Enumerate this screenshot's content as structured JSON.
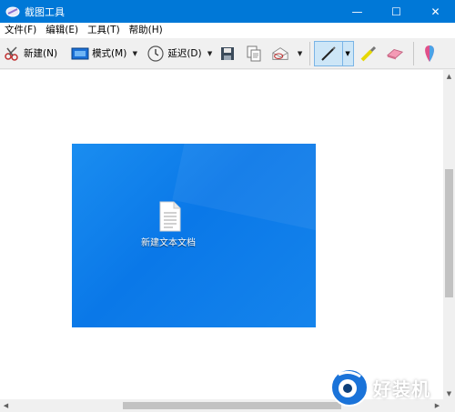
{
  "window": {
    "title": "截图工具",
    "minimize": "—",
    "maximize": "☐",
    "close": "✕"
  },
  "menu": [
    "文件(F)",
    "编辑(E)",
    "工具(T)",
    "帮助(H)"
  ],
  "toolbar": {
    "new_label": "新建(N)",
    "mode_label": "模式(M)",
    "delay_label": "延迟(D)",
    "dropdown_arrow": "▼"
  },
  "capture": {
    "file_label": "新建文本文档"
  },
  "scrollbars": {
    "up": "▲",
    "down": "▼",
    "left": "◀",
    "right": "▶"
  },
  "watermark": {
    "text": "好装机"
  },
  "colors": {
    "titlebar": "#0078d7",
    "desktop": "#0a78e8",
    "pen_selected": "#cde6f7"
  }
}
